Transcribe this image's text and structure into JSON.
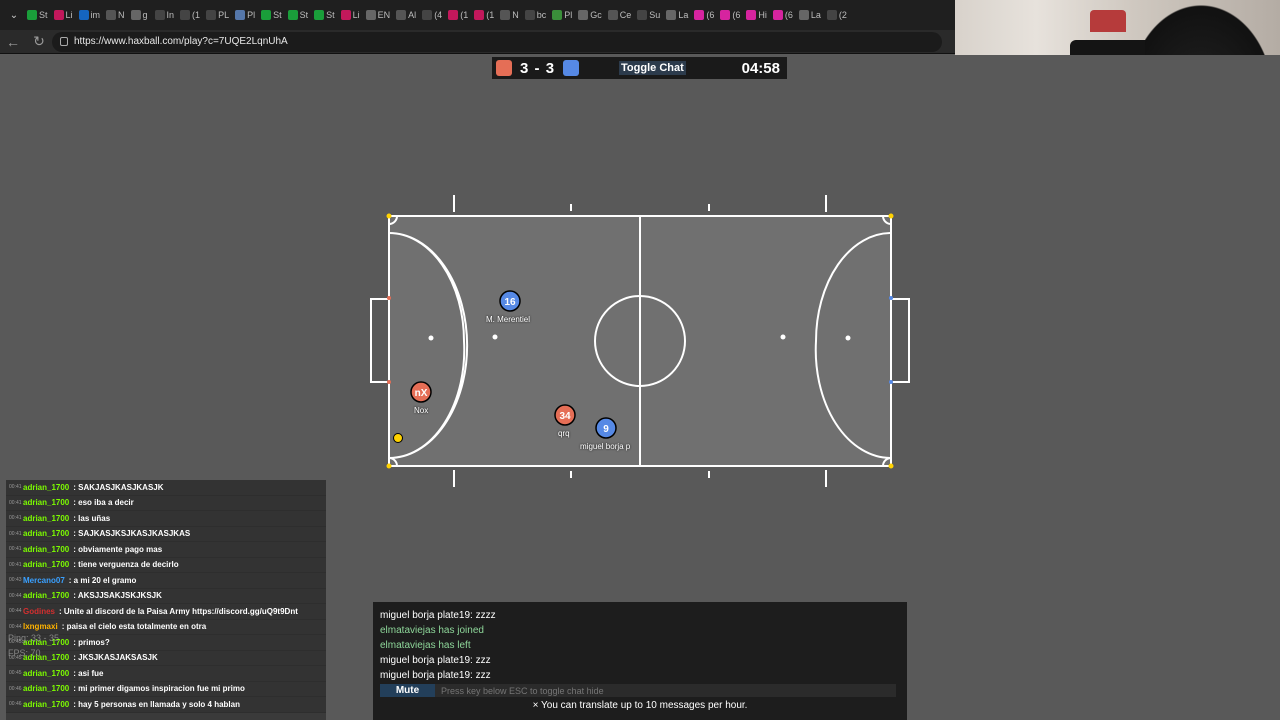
{
  "browser": {
    "tabs": [
      "St",
      "Li",
      "im",
      "N",
      "g",
      "In",
      "(1",
      "PL",
      "Pl",
      "St",
      "St",
      "St",
      "Li",
      "EN",
      "Al",
      "(4",
      "(1",
      "(1",
      "N",
      "bc",
      "Pl",
      "Gc",
      "Ce",
      "Su",
      "La",
      "(6",
      "(6",
      "Hi",
      "(6",
      "La",
      "(2"
    ],
    "tab_colors": [
      "#1a9e3a",
      "#c2185b",
      "#1565c0",
      "#555",
      "#666",
      "#444",
      "#444",
      "#444",
      "#5577aa",
      "#1a9e3a",
      "#1a9e3a",
      "#1a9e3a",
      "#c2185b",
      "#666",
      "#555",
      "#444",
      "#c2185b",
      "#c2185b",
      "#555",
      "#444",
      "#3a8f3a",
      "#666",
      "#555",
      "#444",
      "#666",
      "#d6249f",
      "#d6249f",
      "#d6249f",
      "#d6249f",
      "#666",
      "#444"
    ],
    "url": "https://www.haxball.com/play?c=7UQE2LqnUhA"
  },
  "scoreboard": {
    "red_score": "3",
    "separator": "-",
    "blue_score": "3",
    "toggle_chat": "Toggle Chat",
    "timer": "04:58"
  },
  "players": [
    {
      "avatar": "16",
      "name": "M. Merentiel",
      "team": "blue"
    },
    {
      "avatar": "nX",
      "name": "Nox",
      "team": "red"
    },
    {
      "avatar": "34",
      "name": "qrq",
      "team": "red"
    },
    {
      "avatar": "9",
      "name": "miguel borja p",
      "team": "blue"
    }
  ],
  "colors": {
    "red_team": "#e56e56",
    "blue_team": "#5689e5",
    "ball": "#ffd200",
    "field": "#6e6e6e"
  },
  "side_chat": [
    {
      "time": "00:41",
      "user": "adrian_1700",
      "user_color": "#7cfc00",
      "msg": ": SAKJASJKASJKASJK"
    },
    {
      "time": "00:41",
      "user": "adrian_1700",
      "user_color": "#7cfc00",
      "msg": ": eso iba a decir"
    },
    {
      "time": "00:41",
      "user": "adrian_1700",
      "user_color": "#7cfc00",
      "msg": ": las uñas"
    },
    {
      "time": "00:41",
      "user": "adrian_1700",
      "user_color": "#7cfc00",
      "msg": ": SAJKASJKSJKASJKASJKAS"
    },
    {
      "time": "00:41",
      "user": "adrian_1700",
      "user_color": "#7cfc00",
      "msg": ": obviamente pago mas"
    },
    {
      "time": "00:41",
      "user": "adrian_1700",
      "user_color": "#7cfc00",
      "msg": ": tiene verguenza de decirlo"
    },
    {
      "time": "00:43",
      "user": "Mercano07",
      "user_color": "#3aa0ff",
      "msg": ": a mi 20 el gramo"
    },
    {
      "time": "00:44",
      "user": "adrian_1700",
      "user_color": "#7cfc00",
      "msg": ": AKSJJSAKJSKJKSJK"
    },
    {
      "time": "00:44",
      "user": "Godines",
      "user_color": "#d32f2f",
      "msg": ": Unite al discord de la Paisa Army https://discord.gg/uQ9t9Dnt"
    },
    {
      "time": "00:44",
      "user": "lxngmaxi",
      "user_color": "#ffb300",
      "msg": ": paisa el cielo esta totalmente en otra"
    },
    {
      "time": "00:45",
      "user": "adrian_1700",
      "user_color": "#7cfc00",
      "msg": ": primos?"
    },
    {
      "time": "00:45",
      "user": "adrian_1700",
      "user_color": "#7cfc00",
      "msg": ": JKSJKASJAKSASJK"
    },
    {
      "time": "00:45",
      "user": "adrian_1700",
      "user_color": "#7cfc00",
      "msg": ": asi fue"
    },
    {
      "time": "00:46",
      "user": "adrian_1700",
      "user_color": "#7cfc00",
      "msg": ": mi primer digamos inspiracion fue mi primo"
    },
    {
      "time": "00:46",
      "user": "adrian_1700",
      "user_color": "#7cfc00",
      "msg": ": hay 5 personas en llamada y solo 4 hablan"
    }
  ],
  "overlay": {
    "ping": "Ping: 33 - 35",
    "fps": "FPS: 70"
  },
  "chat": {
    "lines": [
      {
        "text": "miguel borja plate19: zzzz",
        "color": "#ffffff"
      },
      {
        "text": "elmataviejas has joined",
        "color": "#8ed79a"
      },
      {
        "text": "elmataviejas has left",
        "color": "#8ed79a"
      },
      {
        "text": "miguel borja plate19: zzz",
        "color": "#ffffff"
      },
      {
        "text": "miguel borja plate19: zzz",
        "color": "#ffffff"
      }
    ],
    "mute_label": "Mute",
    "input_placeholder": "Press key below ESC to toggle chat hide",
    "translate_note": "× You can translate up to 10 messages per hour."
  }
}
